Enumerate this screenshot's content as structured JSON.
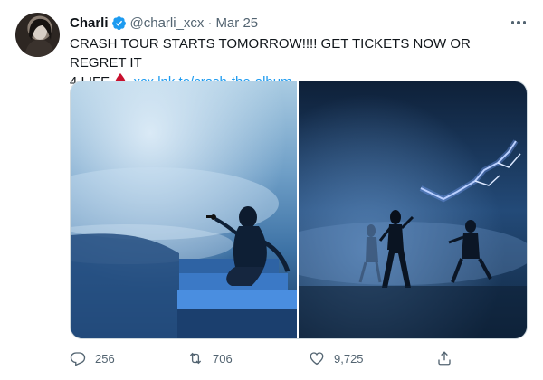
{
  "tweet": {
    "author": {
      "name": "Charli",
      "handle": "@charli_xcx",
      "verified": true,
      "avatar_icon": "avatar-photo"
    },
    "separator": "·",
    "date": "Mar 25",
    "text_line1": "CRASH TOUR STARTS TOMORROW!!!! GET TICKETS NOW OR REGRET IT",
    "text_line2_prefix": "4 LIFE",
    "emoji": "blood-drop-emoji",
    "link": "xcx.lnk.to/crash-the-album",
    "media": [
      {
        "type": "photo",
        "subject": "performer seated on stage steps with microphone, blue smoke"
      },
      {
        "type": "photo",
        "subject": "dancers on stage with lightning projection, blue light"
      }
    ],
    "actions": {
      "reply_count": "256",
      "retweet_count": "706",
      "like_count": "9,725",
      "share_icon": "share-icon"
    }
  },
  "colors": {
    "text": "#0f1419",
    "secondary": "#536471",
    "link": "#1d9bf0",
    "verified": "#1d9bf0",
    "drop": "#c8102e",
    "border": "#cfd9de"
  }
}
